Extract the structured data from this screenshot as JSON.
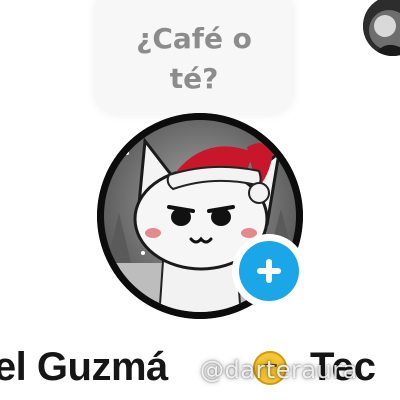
{
  "question_sticker": {
    "line1": "¿Café o",
    "line2": "té?"
  },
  "profile": {
    "avatar_description_icon": "cat-with-santa-hat-avatar",
    "follow_icon": "plus-icon",
    "name_visible": "hel Guzmá",
    "name_tail": "Tec",
    "emoji_icon": "smiling-face-emoji"
  },
  "watermark": {
    "text": "@darteraura"
  },
  "colors": {
    "follow_button": "#1ba6e8",
    "bubble_text": "#8c8c8c",
    "name_text": "#161616",
    "santa_hat": "#c8162a"
  }
}
